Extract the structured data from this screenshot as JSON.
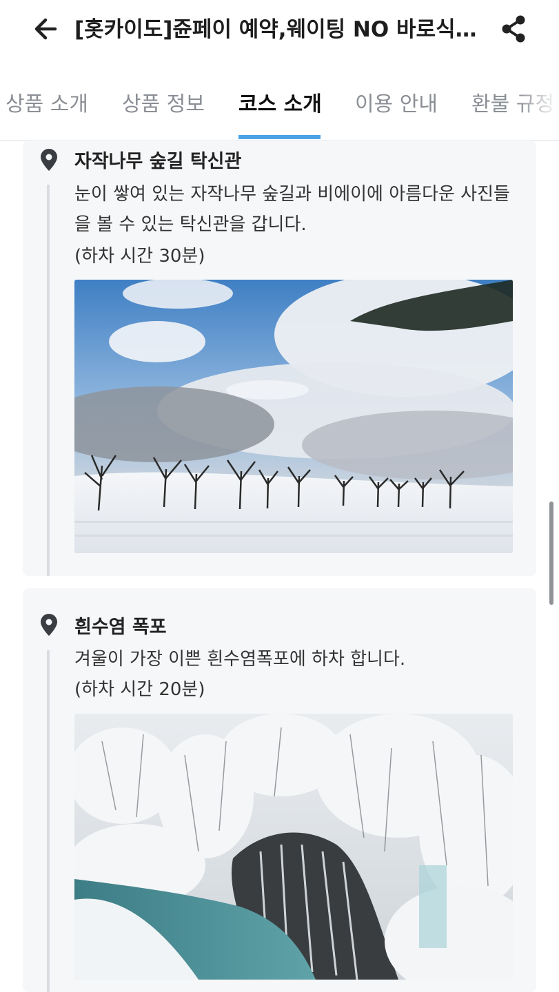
{
  "header": {
    "title": "[홋카이도]쥰페이 예약,웨이팅 NO 바로식사 체험",
    "back_icon": "arrow-left-icon",
    "share_icon": "share-icon"
  },
  "tabs": [
    {
      "label": "상품 소개",
      "active": false
    },
    {
      "label": "상품 정보",
      "active": false
    },
    {
      "label": "코스 소개",
      "active": true
    },
    {
      "label": "이용 안내",
      "active": false
    },
    {
      "label": "환불 규정",
      "active": false
    }
  ],
  "accent_color": "#4aa3e6",
  "course_items": [
    {
      "title": "자작나무 숲길 탁신관",
      "description": "눈이 쌓여 있는 자작나무 숲길과 비에이에 아름다운 사진들을 볼 수 있는 탁신관을 갑니다.",
      "stop_time": "(하차 시간 30분)",
      "photo": "snowy-field-with-trees-photo"
    },
    {
      "title": "흰수염 폭포",
      "description": "겨울이 가장 이쁜 흰수염폭포에 하차 합니다.",
      "stop_time": "(하차 시간 20분)",
      "photo": "frozen-waterfall-photo"
    }
  ]
}
